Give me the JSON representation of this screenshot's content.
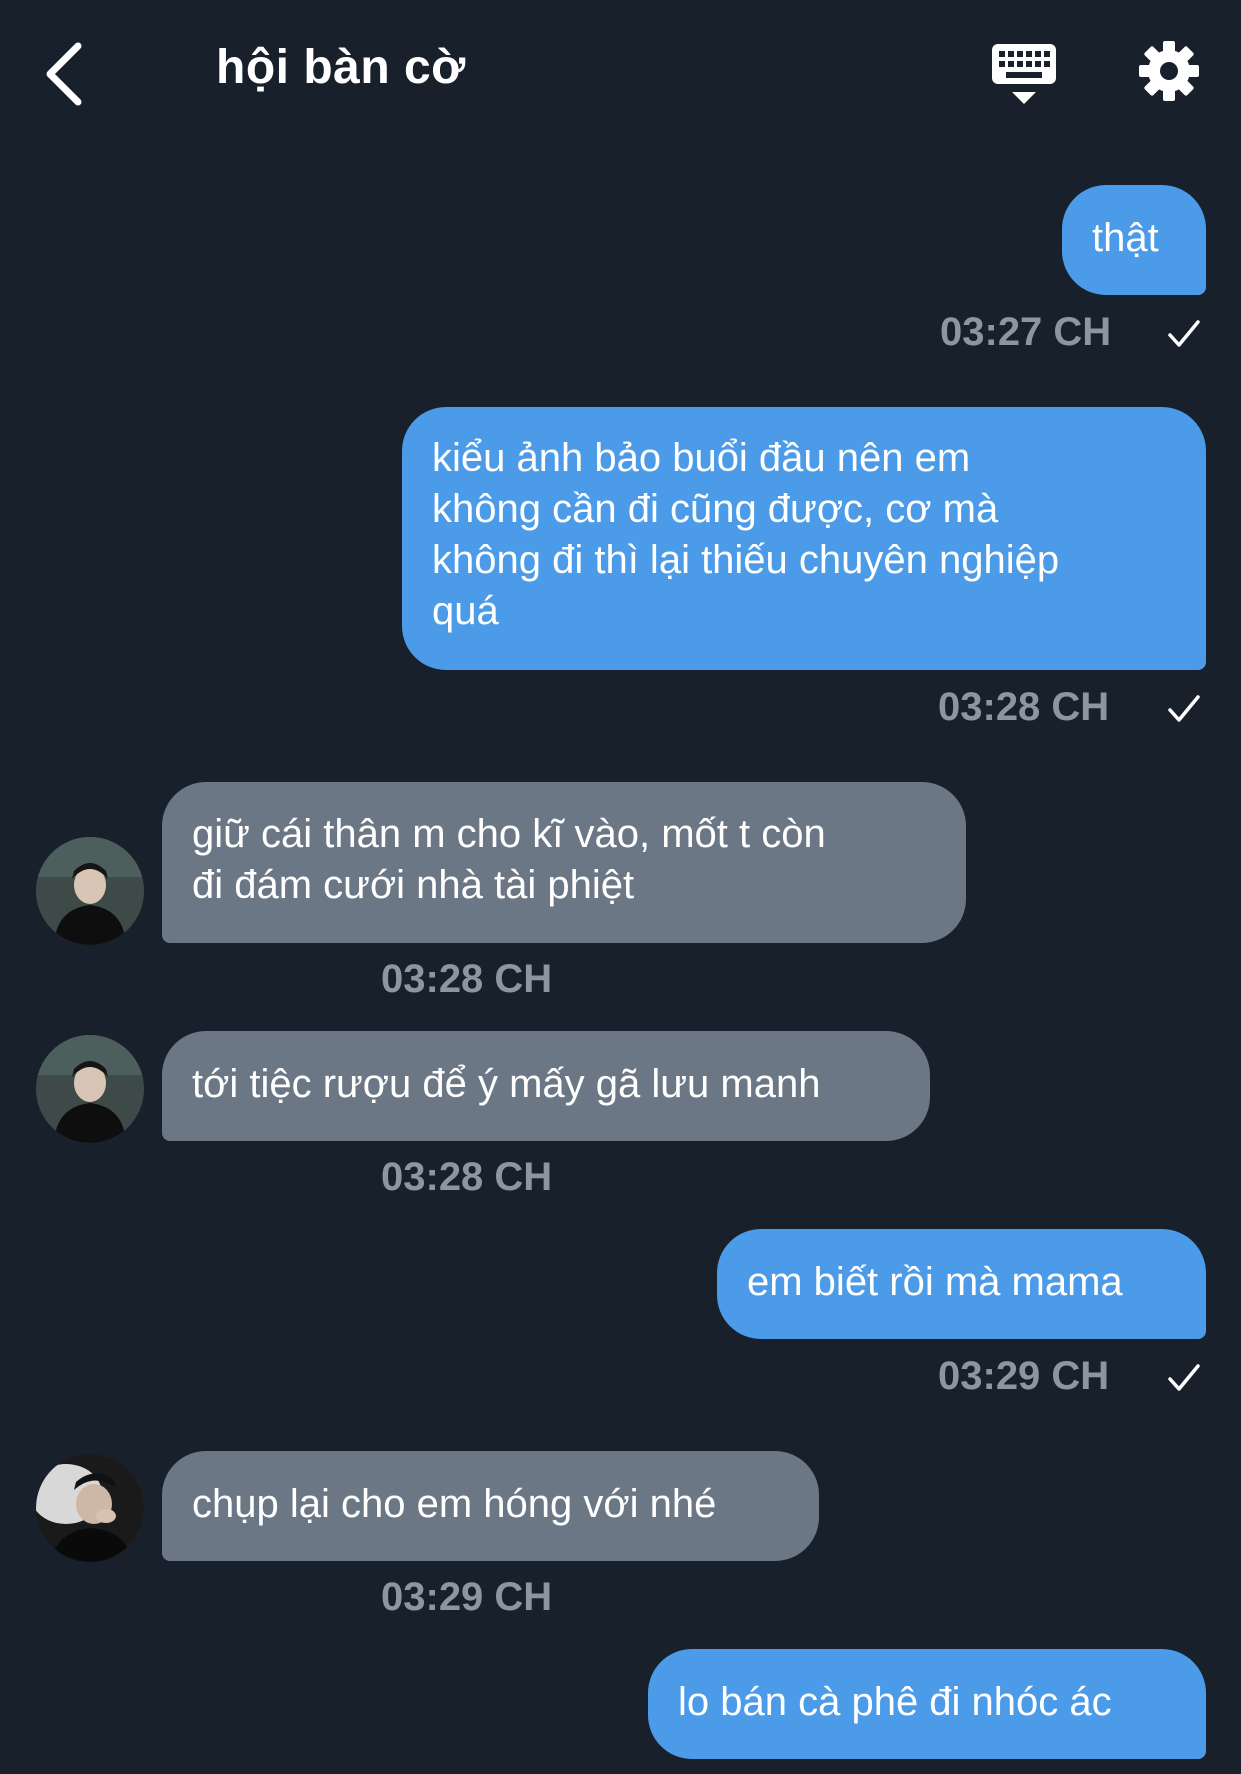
{
  "header": {
    "title": "hội bàn cờ",
    "back_icon": "chevron-left-icon",
    "keyboard_icon": "keyboard-icon",
    "settings_icon": "gear-icon"
  },
  "messages": [
    {
      "direction": "out",
      "text": "thật",
      "time": "03:27 CH",
      "status": "sent"
    },
    {
      "direction": "out",
      "text": "kiểu ảnh bảo buổi đầu nên em\nkhông cần đi cũng được, cơ mà\nkhông đi thì lại thiếu chuyên nghiệp\nquá",
      "time": "03:28 CH",
      "status": "sent"
    },
    {
      "direction": "in",
      "text": "giữ cái thân m cho kĩ vào, mốt t còn\nđi đám cưới nhà tài phiệt",
      "time": "03:28 CH"
    },
    {
      "direction": "in",
      "text": "tới tiệc rượu để ý mấy gã lưu manh",
      "time": "03:28 CH"
    },
    {
      "direction": "out",
      "text": "em biết rồi mà mama",
      "time": "03:29 CH",
      "status": "sent"
    },
    {
      "direction": "in",
      "text": "chụp lại cho em hóng với nhé",
      "time": "03:29 CH"
    },
    {
      "direction": "out",
      "text": "lo bán cà phê đi nhóc ác"
    }
  ],
  "colors": {
    "background": "#18202c",
    "outgoing_bubble": "#4c9be8",
    "incoming_bubble": "#6c7785",
    "timestamp": "#8c96a3"
  }
}
